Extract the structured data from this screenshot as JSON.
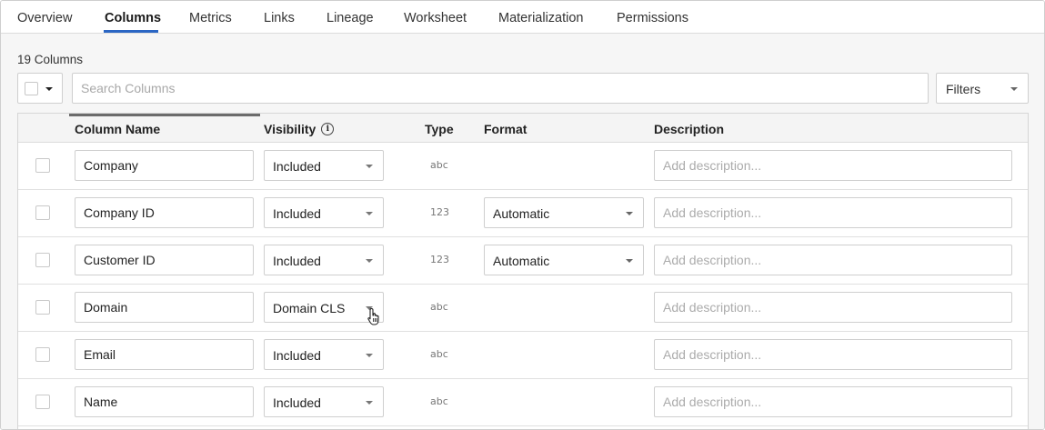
{
  "tabs": [
    "Overview",
    "Columns",
    "Metrics",
    "Links",
    "Lineage",
    "Worksheet",
    "Materialization",
    "Permissions"
  ],
  "active_tab": "Columns",
  "columns_count": "19 Columns",
  "search": {
    "placeholder": "Search Columns",
    "value": ""
  },
  "filters_label": "Filters",
  "headers": {
    "column_name": "Column Name",
    "visibility": "Visibility",
    "visibility_info_icon": "info-icon",
    "type": "Type",
    "format": "Format",
    "description": "Description"
  },
  "rows": [
    {
      "name": "Company",
      "visibility": "Included",
      "type": "abc",
      "format": "",
      "description_placeholder": "Add description..."
    },
    {
      "name": "Company ID",
      "visibility": "Included",
      "type": "123",
      "format": "Automatic",
      "description_placeholder": "Add description..."
    },
    {
      "name": "Customer ID",
      "visibility": "Included",
      "type": "123",
      "format": "Automatic",
      "description_placeholder": "Add description..."
    },
    {
      "name": "Domain",
      "visibility": "Domain CLS",
      "type": "abc",
      "format": "",
      "description_placeholder": "Add description..."
    },
    {
      "name": "Email",
      "visibility": "Included",
      "type": "abc",
      "format": "",
      "description_placeholder": "Add description..."
    },
    {
      "name": "Name",
      "visibility": "Included",
      "type": "abc",
      "format": "",
      "description_placeholder": "Add description..."
    }
  ],
  "colors": {
    "accent": "#2b66c4",
    "border": "#cfcfcf",
    "background": "#f6f6f6"
  }
}
